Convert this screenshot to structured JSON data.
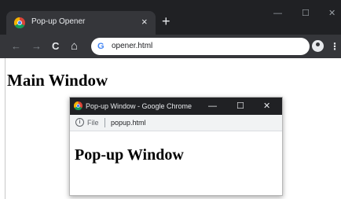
{
  "main_window": {
    "tab": {
      "title": "Pop-up Opener",
      "close_glyph": "×",
      "favicon": "chrome-logo-icon"
    },
    "new_tab_glyph": "+",
    "window_controls": {
      "minimize": "—",
      "maximize": "☐",
      "close": "✕"
    },
    "toolbar": {
      "back": "←",
      "forward": "→",
      "reload": "C",
      "home": "⌂",
      "omnibox_icon": "G",
      "url": "opener.html",
      "menu": "⋮"
    },
    "heading": "Main Window"
  },
  "popup_window": {
    "title": "Pop-up Window - Google Chrome",
    "window_controls": {
      "minimize": "—",
      "maximize": "☐",
      "close": "✕"
    },
    "info_glyph": "i",
    "file_label": "File",
    "url": "popup.html",
    "heading": "Pop-up Window"
  },
  "colors": {
    "frame_dark": "#202124",
    "toolbar": "#35363a",
    "text_light": "#e8eaed",
    "popup_address_bar": "#f1f3f4"
  }
}
